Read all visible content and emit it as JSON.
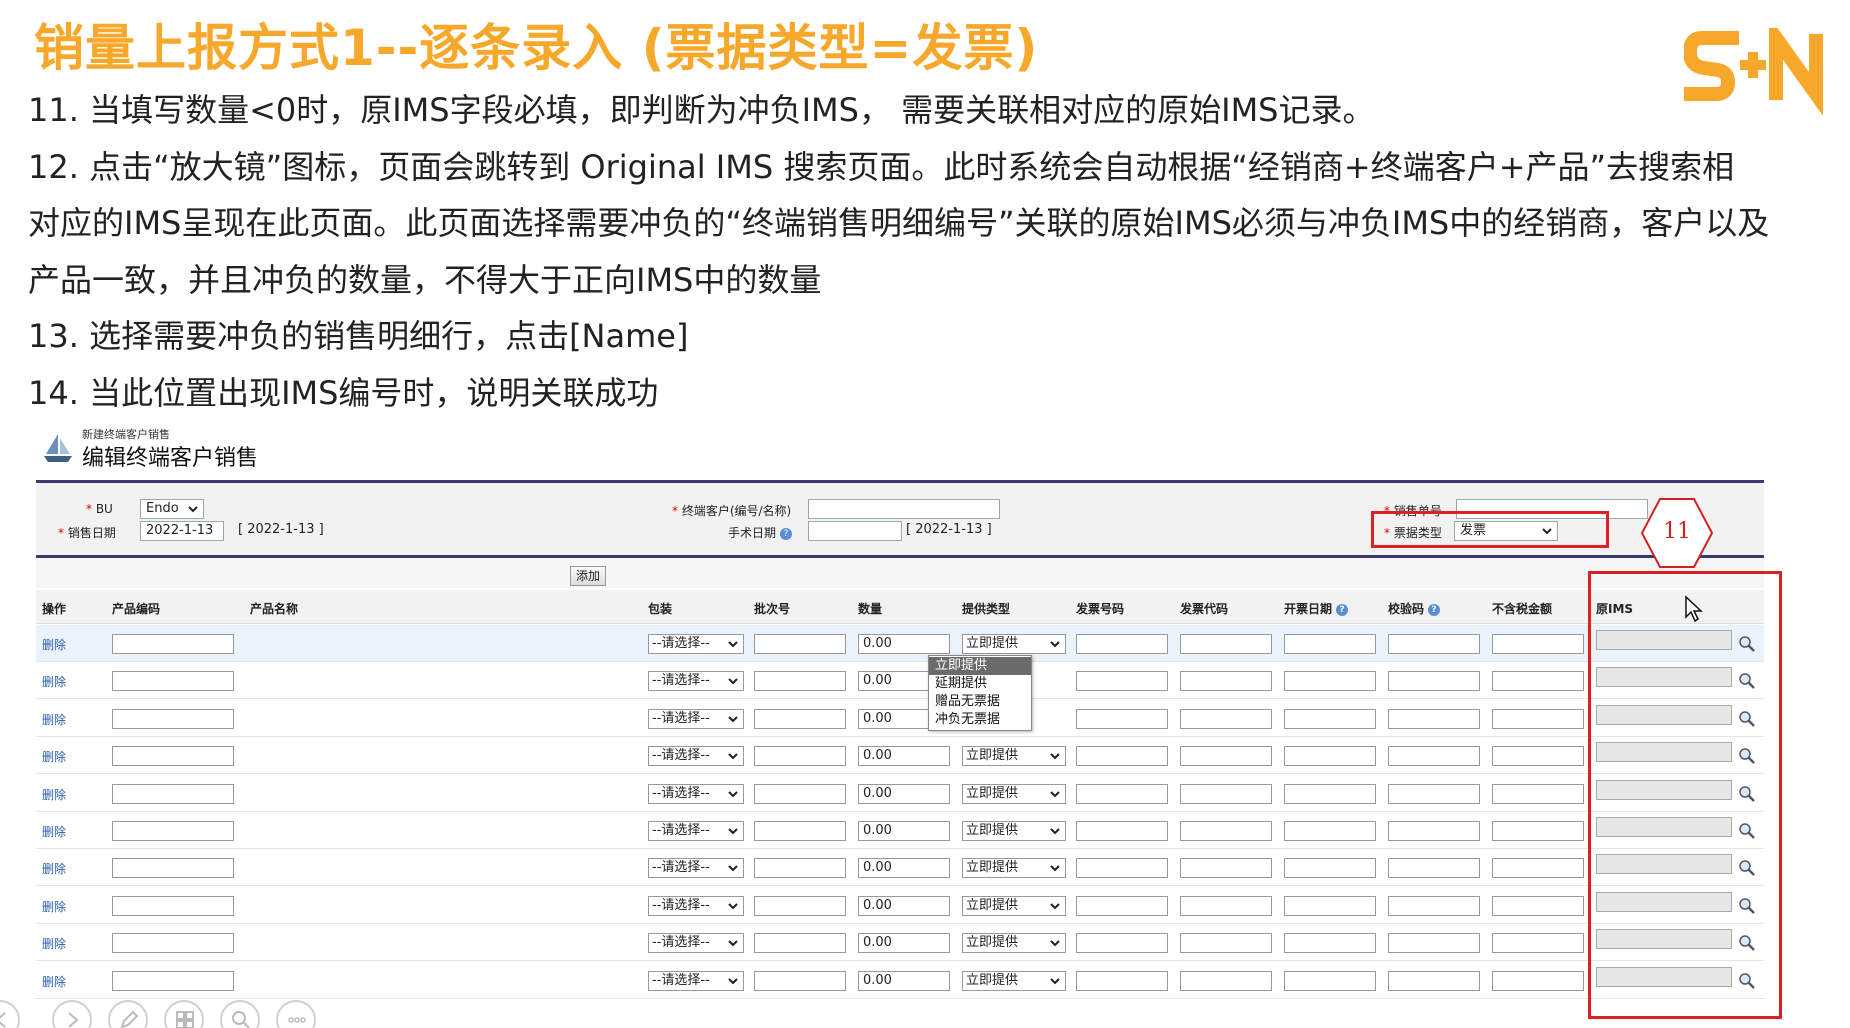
{
  "slide": {
    "title": "销量上报方式1--逐条录入 (票据类型=发票)",
    "logo_text": "S+N",
    "notes": [
      "11. 当填写数量<0时，原IMS字段必填，即判断为冲负IMS， 需要关联相对应的原始IMS记录。",
      "12. 点击“放大镜”图标，页面会跳转到 Original IMS 搜索页面。此时系统会自动根据“经销商+终端客户+产品”去搜索相",
      "对应的IMS呈现在此页面。此页面选择需要冲负的“终端销售明细编号”关联的原始IMS必须与冲负IMS中的经销商，客户以及",
      "产品一致，并且冲负的数量，不得大于正向IMS中的数量",
      "13. 选择需要冲负的销售明细行，点击[Name]",
      "14. 当此位置出现IMS编号时，说明关联成功"
    ],
    "callout_number": "11"
  },
  "form": {
    "breadcrumb": "新建终端客户销售",
    "title": "编辑终端客户销售",
    "bu_label": "BU",
    "bu_value": "Endo",
    "sale_date_label": "销售日期",
    "sale_date_value": "2022-1-13",
    "sale_date_hint": "[ 2022-1-13 ]",
    "customer_label": "终端客户(编号/名称)",
    "customer_value": "",
    "manual_date_label": "手术日期",
    "manual_date_value": "",
    "manual_date_hint": "[ 2022-1-13 ]",
    "sales_no_label": "销售单号",
    "sales_no_value": "",
    "ticket_type_label": "票据类型",
    "ticket_type_value": "发票",
    "add_button": "添加"
  },
  "table": {
    "columns": [
      "操作",
      "产品编码",
      "产品名称",
      "包装",
      "批次号",
      "数量",
      "提供类型",
      "发票号码",
      "发票代码",
      "开票日期",
      "校验码",
      "不含税金额",
      "原IMS"
    ],
    "delete_label": "删除",
    "package_placeholder": "--请选择--",
    "qty_default": "0.00",
    "supply_default": "立即提供",
    "row_count": 10
  },
  "dropdown": {
    "options": [
      "立即提供",
      "延期提供",
      "赠品无票据",
      "冲负无票据"
    ],
    "selected_index": 0
  },
  "colors": {
    "title_orange": "#f7a72a",
    "highlight_red": "#e02020",
    "header_bar": "#3a3a6e",
    "link_blue": "#2a5db0"
  }
}
